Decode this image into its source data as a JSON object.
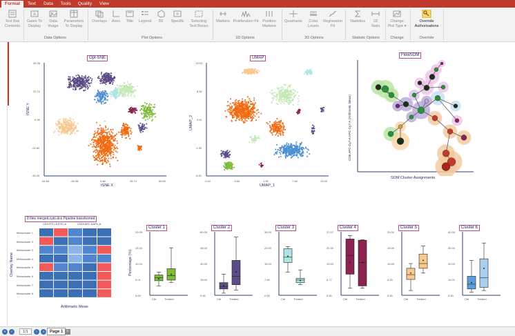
{
  "tabs": [
    {
      "label": "Format"
    },
    {
      "label": "Text"
    },
    {
      "label": "Data"
    },
    {
      "label": "Tools"
    },
    {
      "label": "Quality"
    },
    {
      "label": "View"
    }
  ],
  "ribbon": {
    "buttons": [
      {
        "label": "Text Box Contents",
        "icon": "textbox-icon"
      },
      {
        "label": "Gates To Display",
        "icon": "gates-icon"
      },
      {
        "label": "Data Image",
        "icon": "image-icon"
      },
      {
        "label": "Parameters To Display",
        "icon": "parameters-icon"
      },
      {
        "label": "Overlays",
        "icon": "overlays-icon"
      },
      {
        "label": "Axes",
        "icon": "axes-icon"
      },
      {
        "label": "Title",
        "icon": "title-icon"
      },
      {
        "label": "Legend",
        "icon": "legend-icon"
      },
      {
        "label": "3D",
        "icon": "3d-icon"
      },
      {
        "label": "Specific",
        "icon": "specific-icon"
      },
      {
        "label": "Selecting Text Boxes",
        "icon": "textboxes-icon"
      },
      {
        "label": "Markers",
        "icon": "markers-icon"
      },
      {
        "label": "Proliferation Fit",
        "icon": "proliferation-icon"
      },
      {
        "label": "Position Markers",
        "icon": "position-markers-icon"
      },
      {
        "label": "Quadrants",
        "icon": "quadrants-icon"
      },
      {
        "label": "Color Levels",
        "icon": "color-levels-icon"
      },
      {
        "label": "Regression Fit",
        "icon": "regression-icon"
      },
      {
        "label": "Statistics",
        "icon": "sigma-icon"
      },
      {
        "label": "1D Stats",
        "icon": "stats-icon"
      },
      {
        "label": "Change Plot Type ▾",
        "icon": "change-plot-icon"
      },
      {
        "label": "Override Authorisations",
        "icon": "key-icon"
      }
    ],
    "groups": [
      {
        "label": "Data Options"
      },
      {
        "label": "Plot Options"
      },
      {
        "label": "1D Options"
      },
      {
        "label": "2D Options"
      },
      {
        "label": "Statistic Options"
      },
      {
        "label": "Change"
      },
      {
        "label": "Override"
      }
    ]
  },
  "plots": {
    "optsne": {
      "title": "Opt-SNE",
      "xlabel": "tSNE X",
      "ylabel": "tSNE Y",
      "xticks": [
        "-54.84",
        "-26.98",
        "0.88",
        "28.74",
        "56.60"
      ],
      "yticks": [
        "45.38",
        "22.72",
        "0.06",
        "-22.60",
        "-45.26"
      ]
    },
    "umap": {
      "title": "UMAP",
      "xlabel": "UMAP_1",
      "ylabel": "UMAP_2",
      "xticks": [
        "-9.22",
        "-3.66",
        "1.90",
        "7.46",
        "13.02"
      ],
      "yticks": [
        "13.53",
        "8.52",
        "3.51",
        "-1.50",
        "-6.51"
      ]
    },
    "flowsom": {
      "title": "FlowSOM",
      "xlabel": "SOM Cluster Assignments",
      "ylabel": "CD8 APC-Cy7-A APC-Cy7-A (Arithmetic Mean)",
      "xticks": [
        "1",
        "2",
        "3",
        "4",
        "5",
        "6",
        "7",
        "8",
        "9",
        "10",
        "11",
        "12",
        "13",
        "14",
        "15",
        "16",
        "17"
      ],
      "yticks": [
        "18",
        "16",
        "14",
        "12",
        "10",
        "8",
        "6",
        "4",
        "2",
        "0"
      ]
    },
    "heatmap": {
      "title": "8 files merged.cyto.dcs Pipeline transformed",
      "col_labels": [
        "CD3 FITC-A FITC-A",
        "CD19 APC-A APC-A"
      ],
      "row_labels": [
        "Metacluster 1",
        "Metacluster 2",
        "Metacluster 3",
        "Metacluster 4",
        "Metacluster 5",
        "Metacluster 6",
        "Metacluster 7",
        "Metacluster 8"
      ],
      "ylabel": "Overlay Name",
      "xlabel": "Arithmetic Mean"
    },
    "boxplots": [
      {
        "title": "Cluster 1",
        "ylabel": "Percentage (%)",
        "yticks": [
          "20.05",
          "15.04",
          "10.03",
          "5.01",
          "0.00"
        ],
        "cats": [
          "Ctrl",
          "Treated"
        ]
      },
      {
        "title": "Cluster 2",
        "yticks": [
          "60.00",
          "45.00",
          "30.00",
          "15.00",
          "0.00"
        ],
        "cats": [
          "Ctrl",
          "Treated"
        ]
      },
      {
        "title": "Cluster 3",
        "yticks": [
          "30.00",
          "22.50",
          "15.00",
          "7.50",
          "0.00"
        ],
        "cats": [
          "Ctrl",
          "Treated"
        ]
      },
      {
        "title": "Cluster 4",
        "yticks": [
          "27.07",
          "20.30",
          "13.53",
          "6.77",
          "0.00"
        ],
        "cats": [
          "Ctrl",
          "Treated"
        ]
      },
      {
        "title": "Cluster 5",
        "yticks": [
          "20.00",
          "15.00",
          "10.00",
          "5.00",
          "0.00"
        ],
        "cats": [
          "Ctrl",
          "Treated"
        ]
      },
      {
        "title": "Cluster 6",
        "yticks": [
          "40.05",
          "30.04",
          "20.03",
          "10.01",
          "0.00"
        ],
        "cats": [
          "Ctrl",
          "Treated"
        ]
      }
    ]
  },
  "status": {
    "page_value": "1/1",
    "page_tab": "Page 1"
  },
  "colors": {
    "accent": "#c0392b"
  },
  "chart_data": [
    {
      "type": "box",
      "title": "Cluster 1",
      "ylabel": "Percentage (%)",
      "categories": [
        "Ctrl",
        "Treated"
      ],
      "boxes": [
        {
          "min": 3.0,
          "q1": 4.6,
          "median": 5.6,
          "q3": 6.4,
          "max": 7.3,
          "mean": 5.2
        },
        {
          "min": 4.0,
          "q1": 4.8,
          "median": 6.2,
          "q3": 8.4,
          "max": 15.0,
          "mean": 6.6
        }
      ],
      "ylim": [
        0,
        20.05
      ],
      "colors": [
        "#7dbb3a",
        "#7dbb3a"
      ]
    },
    {
      "type": "box",
      "title": "Cluster 2",
      "categories": [
        "Ctrl",
        "Treated"
      ],
      "boxes": [
        {
          "min": 2.0,
          "q1": 6.0,
          "median": 8.0,
          "q3": 12.0,
          "max": 20.0,
          "mean": 9.0
        },
        {
          "min": 5.0,
          "q1": 10.0,
          "median": 18.0,
          "q3": 33.0,
          "max": 55.0,
          "mean": 22.0
        }
      ],
      "ylim": [
        0,
        60
      ],
      "colors": [
        "#5c4c86",
        "#5c4c86"
      ]
    },
    {
      "type": "box",
      "title": "Cluster 3",
      "categories": [
        "Ctrl",
        "Treated"
      ],
      "boxes": [
        {
          "min": 11.0,
          "q1": 15.5,
          "median": 18.0,
          "q3": 22.0,
          "max": 23.0,
          "mean": 18.5
        },
        {
          "min": 5.0,
          "q1": 6.0,
          "median": 7.2,
          "q3": 8.0,
          "max": 12.0,
          "mean": 7.0
        }
      ],
      "ylim": [
        0,
        30
      ],
      "colors": [
        "#aee4e4",
        "#aee4e4"
      ]
    },
    {
      "type": "box",
      "title": "Cluster 4",
      "categories": [
        "Ctrl",
        "Treated"
      ],
      "boxes": [
        {
          "min": 3.0,
          "q1": 9.0,
          "median": 17.0,
          "q3": 24.0,
          "max": 25.5,
          "mean": 14.0
        },
        {
          "min": 3.0,
          "q1": 4.0,
          "median": 14.0,
          "q3": 23.5,
          "max": 23.7,
          "mean": 14.0
        }
      ],
      "ylim": [
        0,
        27.07
      ],
      "colors": [
        "#8c2351",
        "#8c2351"
      ]
    },
    {
      "type": "box",
      "title": "Cluster 5",
      "categories": [
        "Ctrl",
        "Treated"
      ],
      "boxes": [
        {
          "min": 1.5,
          "q1": 5.0,
          "median": 6.5,
          "q3": 8.5,
          "max": 10.0,
          "mean": 7.0
        },
        {
          "min": 7.0,
          "q1": 8.5,
          "median": 10.0,
          "q3": 13.0,
          "max": 15.5,
          "mean": 11.0
        }
      ],
      "ylim": [
        0,
        20
      ],
      "colors": [
        "#f7c98f",
        "#f7c98f"
      ]
    },
    {
      "type": "box",
      "title": "Cluster 6",
      "categories": [
        "Ctrl",
        "Treated"
      ],
      "boxes": [
        {
          "min": 2.0,
          "q1": 4.0,
          "median": 7.0,
          "q3": 12.0,
          "max": 22.0,
          "mean": 8.0
        },
        {
          "min": 3.0,
          "q1": 5.0,
          "median": 11.0,
          "q3": 23.0,
          "max": 33.0,
          "mean": 17.0
        }
      ],
      "ylim": [
        0,
        40.05
      ],
      "colors": [
        "#5aa0de",
        "#a9cff0"
      ]
    }
  ]
}
